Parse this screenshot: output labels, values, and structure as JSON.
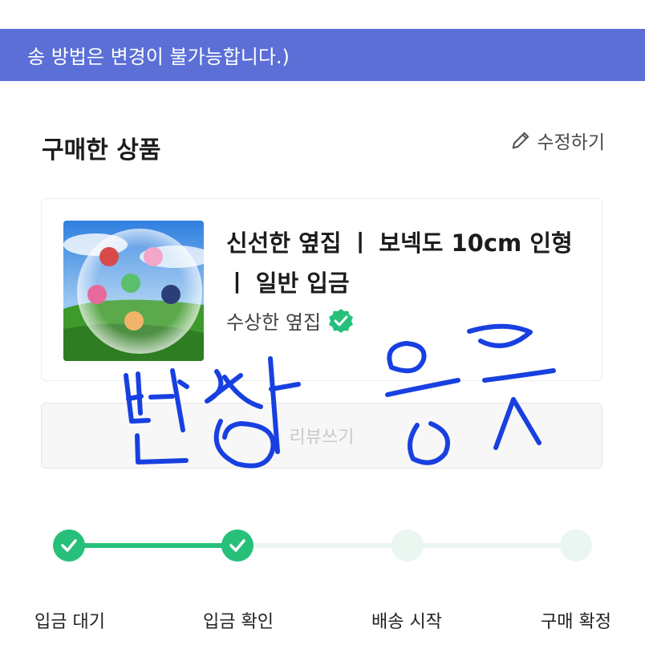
{
  "banner": {
    "text": "송 방법은 변경이 불가능합니다.)"
  },
  "section": {
    "title": "구매한 상품",
    "edit_label": "수정하기"
  },
  "product": {
    "name": "신선한 옆집 ㅣ 보넥도 10cm 인형 ㅣ 일반 입금",
    "seller": "수상한 옆집",
    "image_alt": "plush-dolls-photo",
    "verified_icon": "verified-check-icon"
  },
  "review_button": {
    "label": "리뷰쓰기"
  },
  "handwriting": {
    "text": "번장 응웃",
    "color": "#1840e0"
  },
  "steps": [
    {
      "label": "입금 대기",
      "status": "done"
    },
    {
      "label": "입금 확인",
      "status": "done"
    },
    {
      "label": "배송 시작",
      "status": "pending"
    },
    {
      "label": "구매 확정",
      "status": "pending"
    }
  ],
  "colors": {
    "banner": "#5b6fd6",
    "accent": "#27c07a",
    "pending": "#eaf6f0"
  }
}
